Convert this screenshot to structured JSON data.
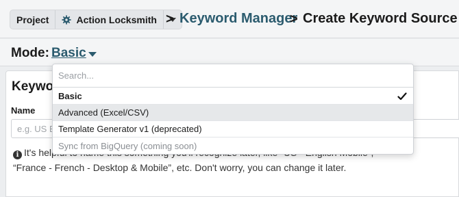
{
  "breadcrumb": {
    "project_label": "Project",
    "project_name": "Action Locksmith",
    "separator": ">",
    "link": "Keyword Manager",
    "current": "Create Keyword Source"
  },
  "mode": {
    "label": "Mode:",
    "value": "Basic"
  },
  "card": {
    "title": "Keyword Source",
    "name_label": "Name",
    "name_placeholder": "e.g. US English Desktop",
    "help_text": "It's helpful to name this something you'll recognize later, like “US - English Mobile”, “France - French - Desktop & Mobile”, etc. Don't worry, you can change it later."
  },
  "dropdown": {
    "search_placeholder": "Search...",
    "options": [
      {
        "label": "Basic",
        "selected": true
      },
      {
        "label": "Advanced (Excel/CSV)",
        "hover": true
      },
      {
        "label": "Template Generator v1 (deprecated)"
      },
      {
        "label": "Sync from BigQuery (coming soon)",
        "disabled": true
      }
    ]
  },
  "colors": {
    "link": "#2b5b6e",
    "background": "#eceef0"
  },
  "icons": [
    "gear-icon",
    "chevron-down-icon",
    "info-icon",
    "checkmark-icon"
  ]
}
